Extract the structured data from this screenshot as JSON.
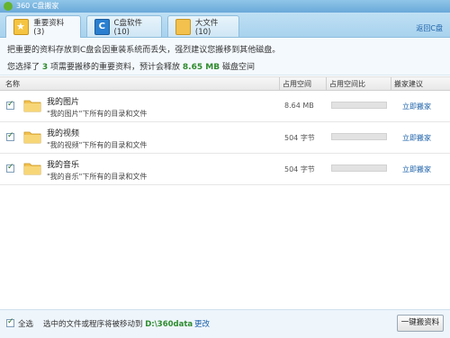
{
  "window": {
    "title": "360 C盘搬家"
  },
  "tabs": [
    {
      "label": "重要资料(3)",
      "icon": "star-folder-icon",
      "active": true
    },
    {
      "label": "C盘软件(10)",
      "icon": "c-drive-icon",
      "active": false
    },
    {
      "label": "大文件(10)",
      "icon": "folder-icon",
      "active": false
    }
  ],
  "back_link": "返回C盘",
  "banner": {
    "line1": "把重要的资料存放到C盘会因重装系统而丢失，强烈建议您搬移到其他磁盘。",
    "line2_prefix": "您选择了",
    "line2_count": "3",
    "line2_mid": "项需要搬移的重要资料，预计会释放",
    "line2_size": "8.65 MB",
    "line2_suffix": "磁盘空间"
  },
  "table": {
    "columns": [
      "名称",
      "占用空间",
      "占用空间比",
      "搬家建议"
    ],
    "rows": [
      {
        "name": "我的图片",
        "desc": "\"我的图片\"下所有的目录和文件",
        "size": "8.64 MB",
        "ratio": 0,
        "action": "立即搬家",
        "checked": true
      },
      {
        "name": "我的视频",
        "desc": "\"我的视频\"下所有的目录和文件",
        "size": "504 字节",
        "ratio": 0,
        "action": "立即搬家",
        "checked": true
      },
      {
        "name": "我的音乐",
        "desc": "\"我的音乐\"下所有的目录和文件",
        "size": "504 字节",
        "ratio": 0,
        "action": "立即搬家",
        "checked": true
      }
    ]
  },
  "footer": {
    "select_all": "全选",
    "move_prefix": "选中的文件或程序将被移动到",
    "path": "D:\\360data",
    "change": "更改",
    "move_button": "一键搬资料"
  },
  "colors": {
    "accent_green": "#2e8b2e",
    "link_blue": "#1a5fa8",
    "tab_bg": "#a8d2ee"
  }
}
